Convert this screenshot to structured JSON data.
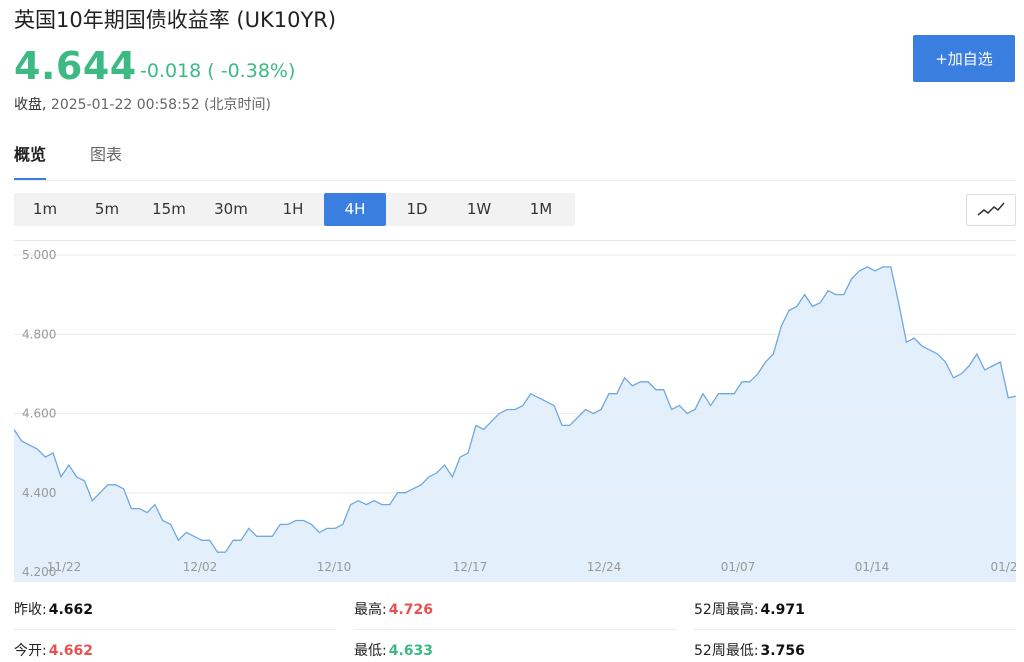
{
  "header": {
    "title": "英国10年期国债收益率 (UK10YR)",
    "price": "4.644",
    "change": "-0.018 ( -0.38%)",
    "status_label": "收盘,",
    "timestamp": "2025-01-22 00:58:52 (北京时间)",
    "add_button": "+加自选"
  },
  "tabs": [
    {
      "label": "概览",
      "active": true
    },
    {
      "label": "图表",
      "active": false
    }
  ],
  "periods": [
    {
      "label": "1m",
      "active": false
    },
    {
      "label": "5m",
      "active": false
    },
    {
      "label": "15m",
      "active": false
    },
    {
      "label": "30m",
      "active": false
    },
    {
      "label": "1H",
      "active": false
    },
    {
      "label": "4H",
      "active": true
    },
    {
      "label": "1D",
      "active": false
    },
    {
      "label": "1W",
      "active": false
    },
    {
      "label": "1M",
      "active": false
    }
  ],
  "chart_type_icon": "line-chart-icon",
  "colors": {
    "accent": "#3a7ee0",
    "down": "#3dba84",
    "up": "#e8514f",
    "line": "#6fa8e0",
    "fill": "#e3effb"
  },
  "chart_data": {
    "type": "area",
    "ylim": [
      4.2,
      5.0
    ],
    "yticks": [
      "5.000",
      "4.800",
      "4.600",
      "4.400",
      "4.200"
    ],
    "xticks": [
      "11/22",
      "12/02",
      "12/10",
      "12/17",
      "12/24",
      "01/07",
      "01/14",
      "01/2"
    ],
    "grid": true,
    "series": [
      {
        "values": [
          4.56,
          4.53,
          4.52,
          4.51,
          4.49,
          4.5,
          4.44,
          4.47,
          4.44,
          4.43,
          4.38,
          4.4,
          4.42,
          4.42,
          4.41,
          4.36,
          4.36,
          4.35,
          4.37,
          4.33,
          4.32,
          4.28,
          4.3,
          4.29,
          4.28,
          4.28,
          4.25,
          4.25,
          4.28,
          4.28,
          4.31,
          4.29,
          4.29,
          4.29,
          4.32,
          4.32,
          4.33,
          4.33,
          4.32,
          4.3,
          4.31,
          4.31,
          4.32,
          4.37,
          4.38,
          4.37,
          4.38,
          4.37,
          4.37,
          4.4,
          4.4,
          4.41,
          4.42,
          4.44,
          4.45,
          4.47,
          4.44,
          4.49,
          4.5,
          4.57,
          4.56,
          4.58,
          4.6,
          4.61,
          4.61,
          4.62,
          4.65,
          4.64,
          4.63,
          4.62,
          4.57,
          4.57,
          4.59,
          4.61,
          4.6,
          4.61,
          4.65,
          4.65,
          4.69,
          4.67,
          4.68,
          4.68,
          4.66,
          4.66,
          4.61,
          4.62,
          4.6,
          4.61,
          4.65,
          4.62,
          4.65,
          4.65,
          4.65,
          4.68,
          4.68,
          4.7,
          4.73,
          4.75,
          4.82,
          4.86,
          4.87,
          4.9,
          4.87,
          4.88,
          4.91,
          4.9,
          4.9,
          4.94,
          4.96,
          4.97,
          4.96,
          4.97,
          4.97,
          4.88,
          4.78,
          4.79,
          4.77,
          4.76,
          4.75,
          4.73,
          4.69,
          4.7,
          4.72,
          4.75,
          4.71,
          4.72,
          4.73,
          4.64,
          4.644
        ]
      }
    ]
  },
  "stats": {
    "prev_close_label": "昨收:",
    "prev_close": "4.662",
    "high_label": "最高:",
    "high": "4.726",
    "week52_high_label": "52周最高:",
    "week52_high": "4.971",
    "open_label": "今开:",
    "open": "4.662",
    "low_label": "最低:",
    "low": "4.633",
    "week52_low_label": "52周最低:",
    "week52_low": "3.756"
  }
}
